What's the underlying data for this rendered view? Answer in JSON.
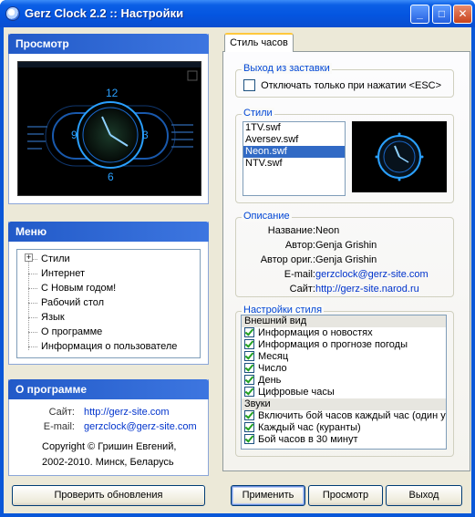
{
  "window": {
    "title": "Gerz Clock 2.2 :: Настройки",
    "buttons": {
      "minimize": "_",
      "maximize": "□",
      "close": "✕"
    }
  },
  "preview_panel": {
    "title": "Просмотр",
    "clock_numbers": [
      "12",
      "3",
      "6",
      "9"
    ]
  },
  "menu_panel": {
    "title": "Меню",
    "items": [
      {
        "label": "Стили",
        "expandable": true
      },
      {
        "label": "Интернет"
      },
      {
        "label": "С Новым годом!"
      },
      {
        "label": "Рабочий стол"
      },
      {
        "label": "Язык"
      },
      {
        "label": "О программе"
      },
      {
        "label": "Информация о пользователе"
      }
    ]
  },
  "about_panel": {
    "title": "О программе",
    "site_label": "Сайт:",
    "site_value": "http://gerz-site.com",
    "email_label": "E-mail:",
    "email_value": "gerzclock@gerz-site.com",
    "copyright_line1": "Copyright © Гришин Евгений,",
    "copyright_line2": "2002-2010. Минск, Беларусь"
  },
  "check_updates_button": "Проверить обновления",
  "tab": {
    "label": "Стиль часов"
  },
  "screensaver_group": {
    "title": "Выход из заставки",
    "checkbox_label": "Отключать только при нажатии <ESC>",
    "checked": false
  },
  "styles_group": {
    "title": "Стили",
    "items": [
      "1TV.swf",
      "Aversev.swf",
      "Neon.swf",
      "NTV.swf"
    ],
    "selected": "Neon.swf"
  },
  "description_group": {
    "title": "Описание",
    "rows": [
      {
        "key": "Название:",
        "value": "Neon",
        "link": false
      },
      {
        "key": "Автор:",
        "value": "Genja Grishin",
        "link": false
      },
      {
        "key": "Автор ориг.:",
        "value": "Genja Grishin",
        "link": false
      },
      {
        "key": "E-mail:",
        "value": "gerzclock@gerz-site.com",
        "link": true
      },
      {
        "key": "Сайт:",
        "value": "http://gerz-site.narod.ru",
        "link": true
      }
    ]
  },
  "style_settings_group": {
    "title": "Настройки стиля",
    "entries": [
      {
        "type": "header",
        "label": "Внешний вид"
      },
      {
        "type": "option",
        "label": "Информация о новостях",
        "checked": true
      },
      {
        "type": "option",
        "label": "Информация о прогнозе погоды",
        "checked": true
      },
      {
        "type": "option",
        "label": "Месяц",
        "checked": true
      },
      {
        "type": "option",
        "label": "Число",
        "checked": true
      },
      {
        "type": "option",
        "label": "День",
        "checked": true
      },
      {
        "type": "option",
        "label": "Цифровые часы",
        "checked": true
      },
      {
        "type": "header",
        "label": "Звуки"
      },
      {
        "type": "option",
        "label": "Включить бой часов каждый час (один у",
        "checked": true
      },
      {
        "type": "option",
        "label": "Каждый час (куранты)",
        "checked": true
      },
      {
        "type": "option",
        "label": "Бой часов в 30 минут",
        "checked": true
      }
    ]
  },
  "footer_buttons": {
    "apply": "Применить",
    "preview": "Просмотр",
    "exit": "Выход"
  },
  "colors": {
    "titlebar": "#0a57d8",
    "panel_header": "#225ac8",
    "selection": "#316ac5",
    "group_title": "#0046d5",
    "link": "#0033cc",
    "neon": "#2aa0ff"
  }
}
